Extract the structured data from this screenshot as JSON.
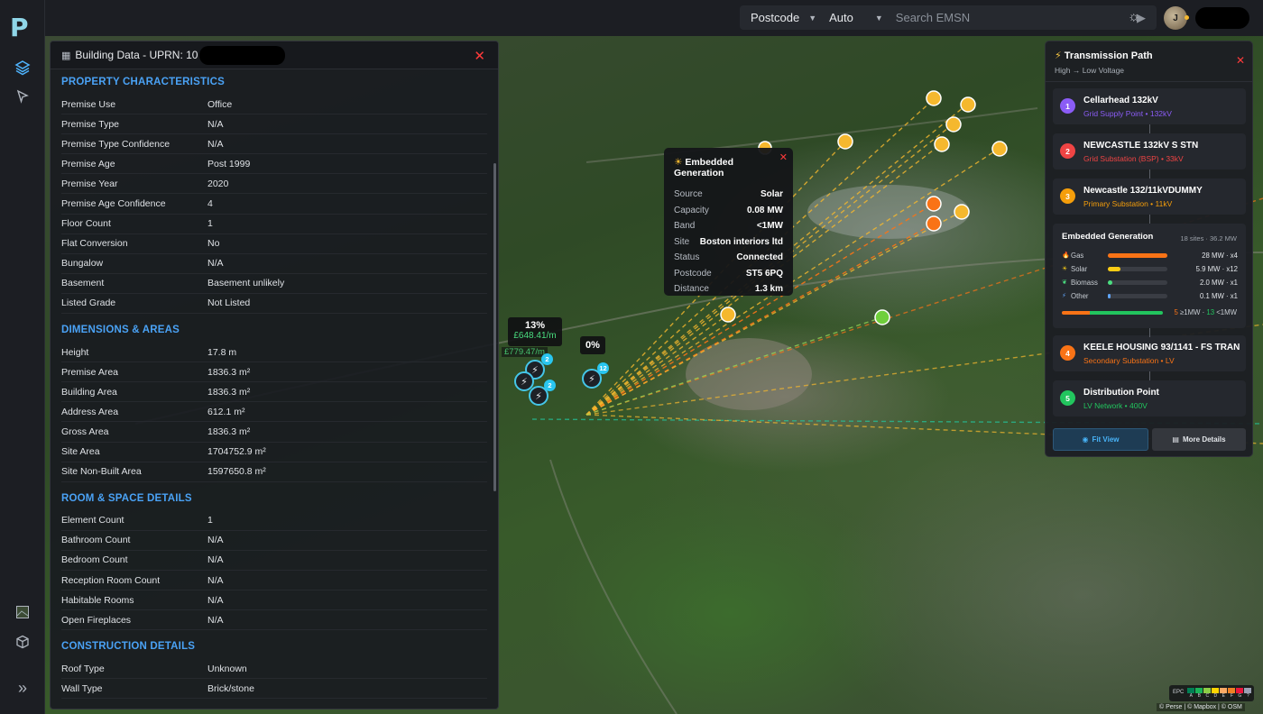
{
  "app": {
    "logo": "P"
  },
  "topbar": {
    "postcode_select": "Postcode",
    "auto_select": "Auto",
    "search_placeholder": "Search EMSN",
    "avatar_initial": "J"
  },
  "building": {
    "title_prefix": "Building Data - UPRN: 10",
    "sections": [
      {
        "title": "PROPERTY CHARACTERISTICS",
        "rows": [
          {
            "k": "Premise Use",
            "v": "Office"
          },
          {
            "k": "Premise Type",
            "v": "N/A"
          },
          {
            "k": "Premise Type Confidence",
            "v": "N/A"
          },
          {
            "k": "Premise Age",
            "v": "Post 1999"
          },
          {
            "k": "Premise Year",
            "v": "2020"
          },
          {
            "k": "Premise Age Confidence",
            "v": "4"
          },
          {
            "k": "Floor Count",
            "v": "1"
          },
          {
            "k": "Flat Conversion",
            "v": "No"
          },
          {
            "k": "Bungalow",
            "v": "N/A"
          },
          {
            "k": "Basement",
            "v": "Basement unlikely"
          },
          {
            "k": "Listed Grade",
            "v": "Not Listed"
          }
        ]
      },
      {
        "title": "DIMENSIONS & AREAS",
        "rows": [
          {
            "k": "Height",
            "v": "17.8 m"
          },
          {
            "k": "Premise Area",
            "v": "1836.3 m²"
          },
          {
            "k": "Building Area",
            "v": "1836.3 m²"
          },
          {
            "k": "Address Area",
            "v": "612.1 m²"
          },
          {
            "k": "Gross Area",
            "v": "1836.3 m²"
          },
          {
            "k": "Site Area",
            "v": "1704752.9 m²"
          },
          {
            "k": "Site Non-Built Area",
            "v": "1597650.8 m²"
          }
        ]
      },
      {
        "title": "ROOM & SPACE DETAILS",
        "rows": [
          {
            "k": "Element Count",
            "v": "1"
          },
          {
            "k": "Bathroom Count",
            "v": "N/A"
          },
          {
            "k": "Bedroom Count",
            "v": "N/A"
          },
          {
            "k": "Reception Room Count",
            "v": "N/A"
          },
          {
            "k": "Habitable Rooms",
            "v": "N/A"
          },
          {
            "k": "Open Fireplaces",
            "v": "N/A"
          }
        ]
      },
      {
        "title": "CONSTRUCTION DETAILS",
        "rows": [
          {
            "k": "Roof Type",
            "v": "Unknown"
          },
          {
            "k": "Wall Type",
            "v": "Brick/stone"
          }
        ]
      }
    ]
  },
  "gen_popup": {
    "title": "Embedded Generation",
    "rows": [
      {
        "k": "Source",
        "v": "Solar"
      },
      {
        "k": "Capacity",
        "v": "0.08 MW"
      },
      {
        "k": "Band",
        "v": "<1MW"
      },
      {
        "k": "Site",
        "v": "Boston interiors ltd"
      },
      {
        "k": "Status",
        "v": "Connected"
      },
      {
        "k": "Postcode",
        "v": "ST5 6PQ"
      },
      {
        "k": "Distance",
        "v": "1.3 km"
      }
    ]
  },
  "map_labels": {
    "pct1": "13%",
    "price1": "£648.41/m",
    "price2": "£779.47/m",
    "pct2": "0%",
    "badge_a": "2",
    "badge_b": "2",
    "badge_c": "12"
  },
  "transmission": {
    "title": "Transmission Path",
    "subtitle": "High → Low Voltage",
    "nodes": [
      {
        "num": "1",
        "name": "Cellarhead 132kV",
        "desc": "Grid Supply Point • 132kV",
        "color": "#8b5cf6"
      },
      {
        "num": "2",
        "name": "NEWCASTLE 132kV S STN",
        "desc": "Grid Substation (BSP) • 33kV",
        "color": "#ef4444"
      },
      {
        "num": "3",
        "name": "Newcastle 132/11kVDUMMY",
        "desc": "Primary Substation • 11kV",
        "color": "#f59e0b"
      },
      {
        "num": "4",
        "name": "KEELE HOUSING 93/1141 - FS TRAN",
        "desc": "Secondary Substation • LV",
        "color": "#f97316"
      },
      {
        "num": "5",
        "name": "Distribution Point",
        "desc": "LV Network • 400V",
        "color": "#22c55e"
      }
    ],
    "embedded": {
      "title": "Embedded Generation",
      "summary": "18 sites · 36.2 MW",
      "rows": [
        {
          "icon": "flame-icon",
          "name": "Gas",
          "value": "28 MW · x4",
          "share": 1.0,
          "color": "#f97316"
        },
        {
          "icon": "sun-icon",
          "name": "Solar",
          "value": "5.9 MW · x12",
          "share": 0.21,
          "color": "#facc15"
        },
        {
          "icon": "leaf-icon",
          "name": "Biomass",
          "value": "2.0 MW · x1",
          "share": 0.07,
          "color": "#4ade80"
        },
        {
          "icon": "bolt-icon",
          "name": "Other",
          "value": "0.1 MW · x1",
          "share": 0.01,
          "color": "#60a5fa"
        }
      ],
      "count_big": "5",
      "count_big_label": "≥1MW",
      "count_small": "13",
      "count_small_label": "<1MW"
    },
    "fit_label": "Fit View",
    "more_label": "More Details"
  },
  "legend": {
    "epc_label": "EPC",
    "grades": [
      "A",
      "B",
      "C",
      "D",
      "E",
      "F",
      "G",
      "?"
    ],
    "colors": [
      "#008054",
      "#19b459",
      "#8dce46",
      "#ffd500",
      "#fcaa65",
      "#ef8023",
      "#e9153b",
      "#9aa0b4"
    ]
  },
  "attribution": "© Perse | © Mapbox | © OSM"
}
